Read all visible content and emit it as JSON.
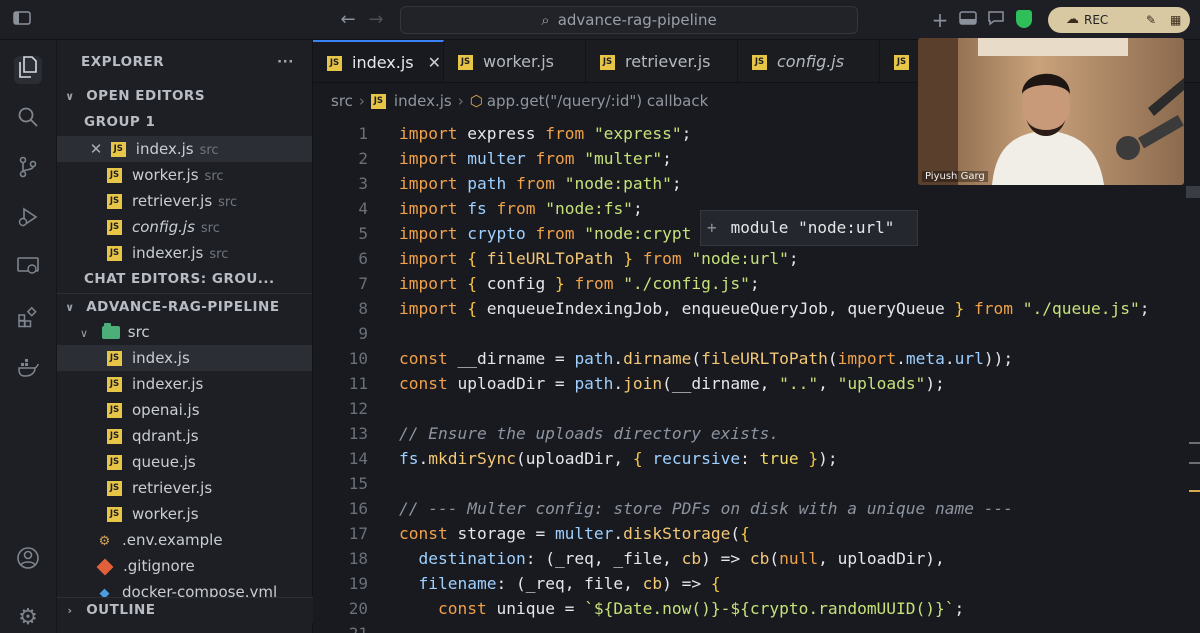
{
  "search": {
    "text": "advance-rag-pipeline"
  },
  "rec": {
    "label": "REC"
  },
  "sidebar": {
    "title": "EXPLORER",
    "more": "···",
    "open_editors": "OPEN EDITORS",
    "group": "GROUP 1",
    "open_files": [
      {
        "name": "index.js",
        "dir": "src"
      },
      {
        "name": "worker.js",
        "dir": "src"
      },
      {
        "name": "retriever.js",
        "dir": "src"
      },
      {
        "name": "config.js",
        "dir": "src"
      },
      {
        "name": "indexer.js",
        "dir": "src"
      }
    ],
    "chat_editors": "CHAT EDITORS: GROU...",
    "project": "ADVANCE-RAG-PIPELINE",
    "folder": "src",
    "files": [
      "index.js",
      "indexer.js",
      "openai.js",
      "qdrant.js",
      "queue.js",
      "retriever.js",
      "worker.js"
    ],
    "env": ".env.example",
    "gitignore": ".gitignore",
    "docker": "docker-compose.yml",
    "outline": "OUTLINE"
  },
  "tabs": [
    {
      "label": "index.js"
    },
    {
      "label": "worker.js"
    },
    {
      "label": "retriever.js"
    },
    {
      "label": "config.js"
    }
  ],
  "breadcrumb": {
    "folder": "src",
    "file": "index.js",
    "symbol": "app.get(\"/query/:id\") callback"
  },
  "hover": {
    "text": "module \"node:url\""
  },
  "webcam": {
    "name": "Piyush Garg"
  },
  "editor": {
    "line_numbers": [
      "1",
      "2",
      "3",
      "4",
      "5",
      "6",
      "7",
      "8",
      "9",
      "10",
      "11",
      "12",
      "13",
      "14",
      "15",
      "16",
      "17",
      "18",
      "19",
      "20",
      "21"
    ],
    "lines": [
      "import express from \"express\";",
      "import multer from \"multer\";",
      "import path from \"node:path\";",
      "import fs from \"node:fs\";",
      "import crypto from \"node:crypt",
      "import { fileURLToPath } from \"node:url\";",
      "import { config } from \"./config.js\";",
      "import { enqueueIndexingJob, enqueueQueryJob, queryQueue } from \"./queue.js\";",
      "",
      "const __dirname = path.dirname(fileURLToPath(import.meta.url));",
      "const uploadDir = path.join(__dirname, \"..\", \"uploads\");",
      "",
      "// Ensure the uploads directory exists.",
      "fs.mkdirSync(uploadDir, { recursive: true });",
      "",
      "// --- Multer config: store PDFs on disk with a unique name ---",
      "const storage = multer.diskStorage({",
      "  destination: (_req, _file, cb) => cb(null, uploadDir),",
      "  filename: (_req, file, cb) => {",
      "    const unique = `${Date.now()}-${crypto.randomUUID()}`;"
    ]
  },
  "colors": {
    "background": "#181a1f",
    "keyword": "#f0a14a",
    "string": "#c7e17a",
    "accent": "#3b82f6",
    "js_badge": "#e7c547"
  }
}
